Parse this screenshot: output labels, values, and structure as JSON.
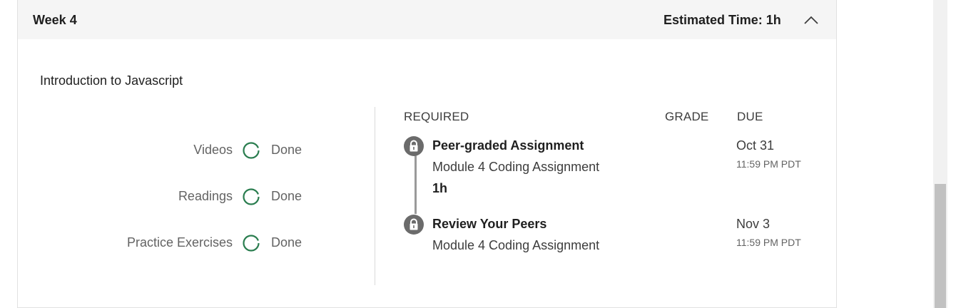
{
  "header": {
    "week_title": "Week 4",
    "estimated_time": "Estimated Time: 1h"
  },
  "module": {
    "title": "Introduction to Javascript"
  },
  "progress": [
    {
      "label": "Videos",
      "status": "Done"
    },
    {
      "label": "Readings",
      "status": "Done"
    },
    {
      "label": "Practice Exercises",
      "status": "Done"
    }
  ],
  "columns": {
    "required": "REQUIRED",
    "grade": "GRADE",
    "due": "DUE"
  },
  "assignments": [
    {
      "title": "Peer-graded Assignment",
      "subtitle": "Module 4 Coding Assignment",
      "duration": "1h",
      "due_date": "Oct 31",
      "due_time": "11:59 PM PDT",
      "icon": "lock-icon"
    },
    {
      "title": "Review Your Peers",
      "subtitle": "Module 4 Coding Assignment",
      "due_date": "Nov 3",
      "due_time": "11:59 PM PDT",
      "icon": "lock-icon"
    }
  ],
  "colors": {
    "accent_green": "#2a7d4f",
    "header_bg": "#f5f5f5",
    "lock_gray": "#6b6b6b"
  }
}
